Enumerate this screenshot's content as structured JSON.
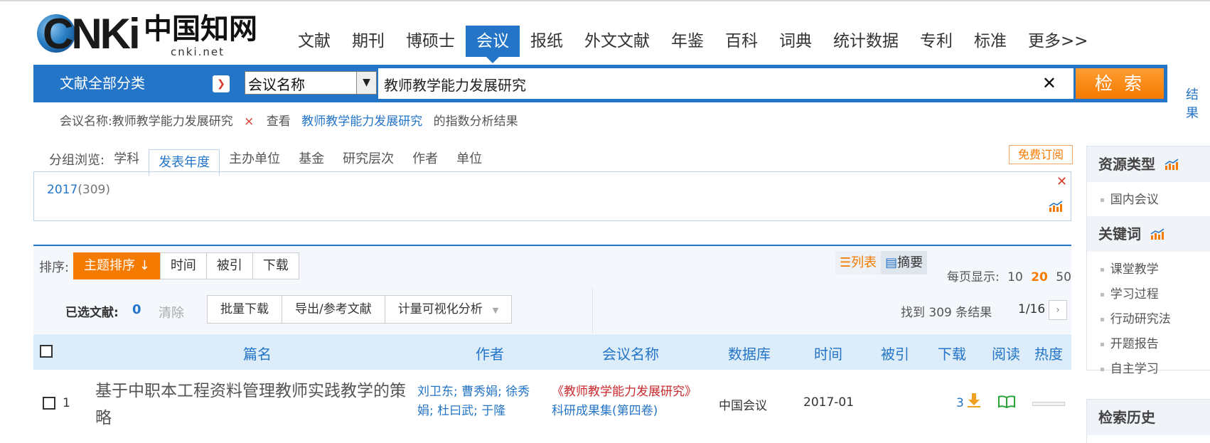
{
  "logo": {
    "brand": "CNKi",
    "cn": "中国知网",
    "url": "cnki.net"
  },
  "nav": {
    "items": [
      "文献",
      "期刊",
      "博硕士",
      "会议",
      "报纸",
      "外文文献",
      "年鉴",
      "百科",
      "词典",
      "统计数据",
      "专利",
      "标准",
      "更多>>"
    ],
    "active": "会议"
  },
  "search": {
    "category": "文献全部分类",
    "field": "会议名称",
    "query": "教师教学能力发展研究",
    "button": "检 索",
    "side_link": "结果"
  },
  "condition": {
    "label": "会议名称:教师教学能力发展研究",
    "close": "×",
    "view": "查看",
    "keyword": "教师教学能力发展研究",
    "suffix": "的指数分析结果"
  },
  "group": {
    "label": "分组浏览:",
    "tabs": [
      "学科",
      "发表年度",
      "主办单位",
      "基金",
      "研究层次",
      "作者",
      "单位"
    ],
    "active": "发表年度",
    "subscribe": "免费订阅",
    "year": "2017",
    "year_count": "(309)"
  },
  "sort": {
    "label": "排序:",
    "buttons": [
      "主题排序",
      "时间",
      "被引",
      "下载"
    ],
    "active": "主题排序",
    "views": [
      "列表",
      "摘要"
    ],
    "per_page_label": "每页显示:",
    "per_page": [
      "10",
      "20",
      "50"
    ],
    "per_page_active": "20"
  },
  "selection": {
    "label": "已选文献:",
    "count": "0",
    "clear": "清除",
    "actions": [
      "批量下载",
      "导出/参考文献",
      "计量可视化分析"
    ],
    "found": "找到 309 条结果",
    "pager": "1/16"
  },
  "table": {
    "headers": {
      "title": "篇名",
      "author": "作者",
      "conference": "会议名称",
      "db": "数据库",
      "time": "时间",
      "cited": "被引",
      "download": "下载",
      "read": "阅读",
      "heat": "热度"
    },
    "rows": [
      {
        "n": "1",
        "title": "基于中职本工程资料管理教师实践教学的策略",
        "authors": "刘卫东; 曹秀娟; 徐秀娟; 杜曰武; 于隆",
        "conference_a": "《教师教学能力发展研究》",
        "conference_b": "科研成果集(第四卷)",
        "db": "中国会议",
        "time": "2017-01",
        "cited": "",
        "downloads": "3"
      }
    ]
  },
  "sidebar": {
    "resource": {
      "title": "资源类型",
      "items": [
        "国内会议"
      ]
    },
    "keywords": {
      "title": "关键词",
      "items": [
        "课堂教学",
        "学习过程",
        "行动研究法",
        "开题报告",
        "自主学习"
      ]
    },
    "history": {
      "title": "检索历史"
    }
  },
  "colors": {
    "primary": "#2475c7",
    "accent": "#f57a00",
    "danger": "#d9392b"
  }
}
